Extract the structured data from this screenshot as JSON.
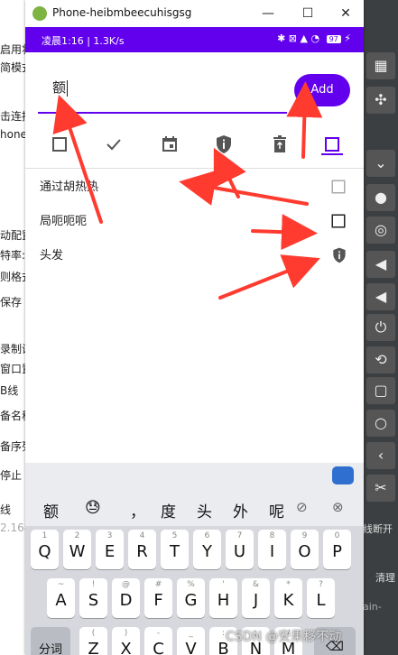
{
  "background": {
    "left_lines": [
      "启用将",
      "简模式",
      "击连接",
      "hone",
      "动配置",
      "特率:",
      "则格式",
      "保存",
      "录制设",
      "窗口置",
      "B线",
      "备名称",
      "备序列",
      "停止",
      "线",
      "2.168"
    ],
    "right_lines": [
      "线断开",
      "清理",
      "ain-"
    ]
  },
  "window": {
    "title": "Phone-heibmbeecuhisgsg",
    "minimize": "—",
    "maximize": "☐",
    "close": "✕"
  },
  "statusbar": {
    "left": "凌晨1:16 | 1.3K/s",
    "right_icons": "✱ ⊠ ▲ ◔",
    "battery": "97"
  },
  "app": {
    "input_value": "额",
    "add_label": "Add",
    "toolbar_icons": [
      "checkbox-outline-icon",
      "check-icon",
      "calendar-icon",
      "shield-info-icon",
      "delete-icon",
      "checkbox-outline-selected-icon"
    ],
    "items": [
      {
        "text": "通过胡热热",
        "icon": "checkbox-light-icon"
      },
      {
        "text": "局呃呃呃",
        "icon": "checkbox-outline-icon"
      },
      {
        "text": "头发",
        "icon": "shield-info-icon"
      }
    ]
  },
  "keyboard": {
    "candidates": [
      "额",
      "😓",
      "，",
      "度",
      "头",
      "外",
      "呢"
    ],
    "row1": [
      {
        "s": "1",
        "m": "Q"
      },
      {
        "s": "2",
        "m": "W"
      },
      {
        "s": "3",
        "m": "E"
      },
      {
        "s": "4",
        "m": "R"
      },
      {
        "s": "5",
        "m": "T"
      },
      {
        "s": "6",
        "m": "Y"
      },
      {
        "s": "7",
        "m": "U"
      },
      {
        "s": "8",
        "m": "I"
      },
      {
        "s": "9",
        "m": "O"
      },
      {
        "s": "0",
        "m": "P"
      }
    ],
    "row2": [
      {
        "s": "~",
        "m": "A"
      },
      {
        "s": "!",
        "m": "S"
      },
      {
        "s": "@",
        "m": "D"
      },
      {
        "s": "#",
        "m": "F"
      },
      {
        "s": "%",
        "m": "G"
      },
      {
        "s": "'",
        "m": "H"
      },
      {
        "s": "&",
        "m": "J"
      },
      {
        "s": "*",
        "m": "K"
      },
      {
        "s": "?",
        "m": "L"
      }
    ],
    "row3_left": "分词",
    "row3": [
      {
        "s": "(",
        "m": "Z"
      },
      {
        "s": ")",
        "m": "X"
      },
      {
        "s": "-",
        "m": "C"
      },
      {
        "s": "_",
        "m": "V"
      },
      {
        "s": ":",
        "m": "B"
      },
      {
        "s": ";",
        "m": "N"
      },
      {
        "s": "/",
        "m": "M"
      }
    ]
  },
  "watermark": "CSDN @安果移不动"
}
